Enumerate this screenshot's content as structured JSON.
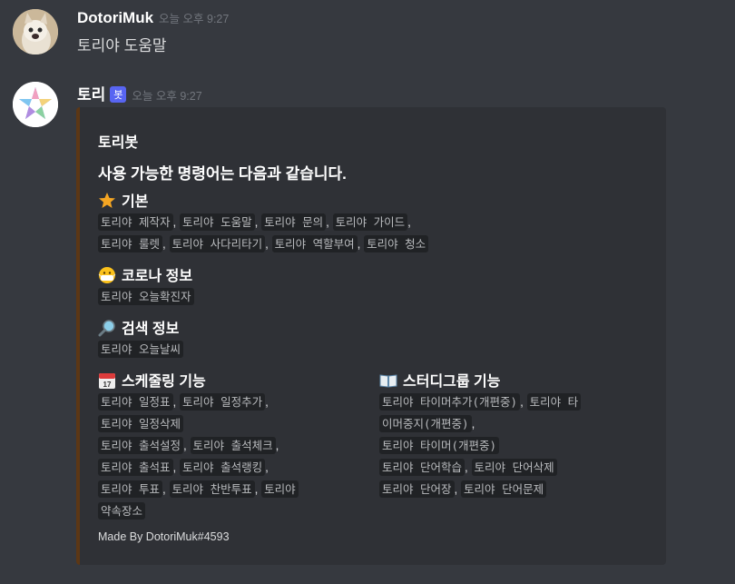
{
  "message1": {
    "author": "DotoriMuk",
    "timestamp": "오늘 오후 9:27",
    "content": "토리야 도움말"
  },
  "message2": {
    "author": "토리",
    "bot_tag": "봇",
    "timestamp": "오늘 오후 9:27",
    "embed": {
      "title": "토리봇",
      "description": "사용 가능한 명령어는 다음과 같습니다.",
      "accent_color": "#5c3715",
      "fields": {
        "basic": {
          "icon": "star-icon",
          "name": "기본",
          "line1": [
            "토리야 제작자",
            "토리야 도움말",
            "토리야 문의",
            "토리야 가이드"
          ],
          "line2": [
            "토리야 룰렛",
            "토리야 사다리타기",
            "토리야 역할부여",
            "토리야 청소"
          ]
        },
        "corona": {
          "icon": "mask-face-icon",
          "name": "코로나 정보",
          "items": [
            "토리야 오늘확진자"
          ]
        },
        "search": {
          "icon": "magnifier-icon",
          "name": "검색 정보",
          "items": [
            "토리야 오늘날씨"
          ]
        },
        "schedule": {
          "icon": "calendar-icon",
          "name": "스케줄링 기능",
          "lines": [
            [
              "토리야 일정표",
              "토리야 일정추가"
            ],
            [
              "토리야 일정삭제"
            ],
            [
              "토리야 출석설정",
              "토리야 출석체크"
            ],
            [
              "토리야 출석표",
              "토리야 출석랭킹"
            ],
            [
              "토리야 투표",
              "토리야 찬반투표",
              "토리야"
            ],
            [
              "약속장소"
            ]
          ]
        },
        "study": {
          "icon": "book-icon",
          "name": "스터디그룹 기능",
          "lines": [
            [
              "토리야 타이머추가(개편중)",
              "토리야 타"
            ],
            [
              "이머중지(개편중)"
            ],
            [
              "토리야 타이머(개편중)"
            ],
            [
              "토리야 단어학습",
              "토리야 단어삭제"
            ],
            [
              "토리야 단어장",
              "토리야 단어문제"
            ]
          ]
        }
      },
      "footer": "Made By DotoriMuk#4593"
    }
  }
}
